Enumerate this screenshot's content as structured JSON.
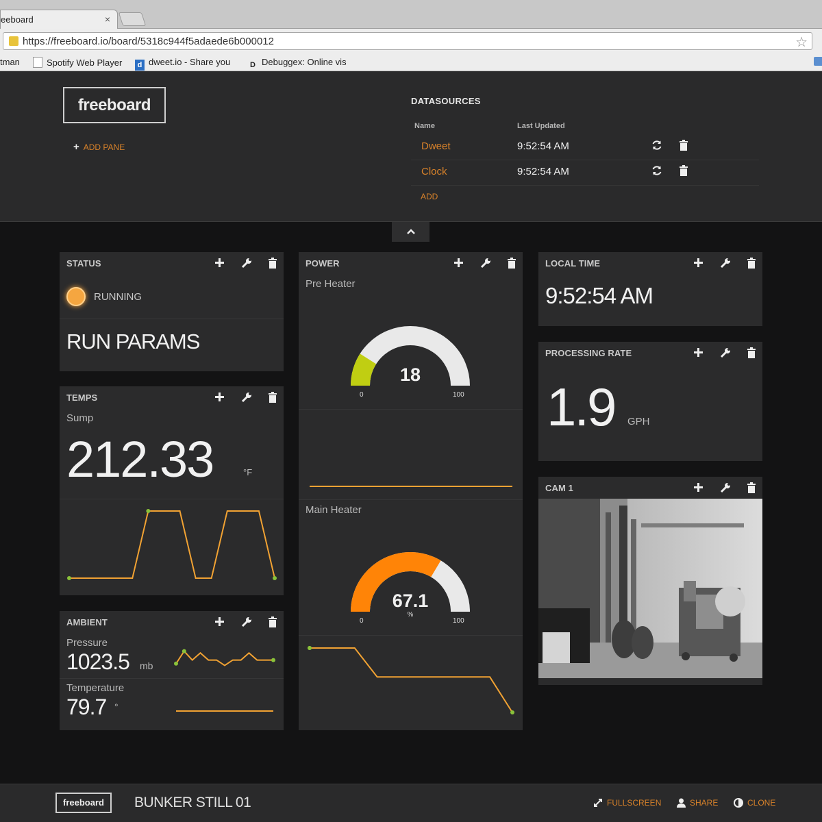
{
  "browser": {
    "tab_title": "eeboard",
    "tab_close": "×",
    "url": "https://freeboard.io/board/5318c944f5adaede6b000012",
    "bookmarks": [
      {
        "label": "tman"
      },
      {
        "label": "Spotify Web Player",
        "icon": "page-icon"
      },
      {
        "label": "dweet.io - Share you",
        "icon": "d"
      },
      {
        "label": "Debuggex: Online vis",
        "icon": "D"
      }
    ]
  },
  "header": {
    "logo": "freeboard",
    "add_pane": "ADD PANE",
    "datasources": {
      "title": "DATASOURCES",
      "col_name": "Name",
      "col_updated": "Last Updated",
      "rows": [
        {
          "name": "Dweet",
          "updated": "9:52:54 AM"
        },
        {
          "name": "Clock",
          "updated": "9:52:54 AM"
        }
      ],
      "add": "ADD"
    }
  },
  "panes": {
    "status": {
      "title": "STATUS",
      "indicator": "RUNNING",
      "indicator_color": "#f5a640",
      "text": "RUN PARAMS"
    },
    "temps": {
      "title": "TEMPS",
      "label": "Sump",
      "value": "212.33",
      "unit": "°F",
      "sparkline": [
        0,
        0,
        0,
        0,
        0,
        1,
        1,
        1,
        0,
        0,
        1,
        1,
        1,
        0
      ]
    },
    "ambient": {
      "title": "AMBIENT",
      "pressure_label": "Pressure",
      "pressure_value": "1023.5",
      "pressure_unit": "mb",
      "pressure_sparkline": [
        0.2,
        0.9,
        0.4,
        0.8,
        0.4,
        0.4,
        0.1,
        0.4,
        0.4,
        0.8,
        0.4,
        0.4,
        0.4
      ],
      "temperature_label": "Temperature",
      "temperature_value": "79.7",
      "temperature_unit": "°",
      "temperature_sparkline": [
        0.5,
        0.5,
        0.5,
        0.5
      ]
    },
    "power": {
      "title": "POWER",
      "pre_heater": {
        "label": "Pre Heater",
        "value": "18",
        "min": "0",
        "max": "100",
        "fraction": 0.18,
        "color": "#c0ce12",
        "sparkline": [
          0.5,
          0.5,
          0.5,
          0.5
        ]
      },
      "main_heater": {
        "label": "Main Heater",
        "value": "67.1",
        "unit": "%",
        "min": "0",
        "max": "100",
        "fraction": 0.671,
        "color": "#ff8407",
        "sparkline": [
          1,
          1,
          1,
          0.55,
          0.55,
          0.55,
          0.55,
          0.55,
          0.55,
          0
        ]
      }
    },
    "local_time": {
      "title": "LOCAL TIME",
      "value": "9:52:54 AM"
    },
    "processing_rate": {
      "title": "PROCESSING RATE",
      "value": "1.9",
      "unit": "GPH"
    },
    "cam": {
      "title": "CAM 1"
    }
  },
  "footer": {
    "logo": "freeboard",
    "title": "BUNKER STILL 01",
    "fullscreen": "FULLSCREEN",
    "share": "SHARE",
    "clone": "CLONE"
  },
  "colors": {
    "accent": "#d8822a",
    "spark": "#f1a233",
    "spark_dot": "#8ac23a",
    "gauge_track": "#e9e9e9"
  }
}
